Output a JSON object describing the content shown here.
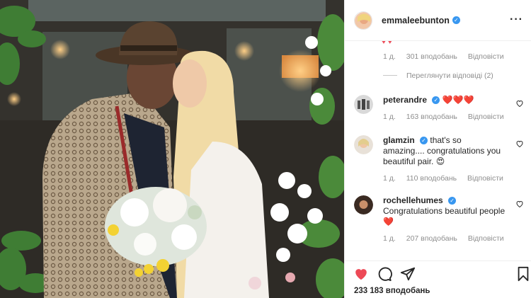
{
  "post": {
    "username": "emmaleebunton",
    "likes_label": "233 183 вподобань"
  },
  "top_meta": {
    "hearts": "♥ ♥",
    "time": "1 д.",
    "likes": "301 вподобань",
    "reply": "Відповісти",
    "view_replies": "Переглянути відповіді (2)"
  },
  "comments": [
    {
      "username": "peterandre",
      "text": "",
      "emoji": "❤️❤️❤️",
      "time": "1 д.",
      "likes": "163 вподобань",
      "reply": "Відповісти"
    },
    {
      "username": "glamzin",
      "text": "that's so amazing.... congratulations you beautiful pair.",
      "emoji": "😍",
      "time": "1 д.",
      "likes": "110 вподобань",
      "reply": "Відповісти"
    },
    {
      "username": "rochellehumes",
      "text": "Congratulations beautiful people",
      "emoji": "❤️",
      "time": "1 д.",
      "likes": "207 вподобань",
      "reply": "Відповісти"
    }
  ],
  "icons": {
    "like": "heart-icon",
    "comment": "comment-icon",
    "share": "share-icon",
    "save": "bookmark-icon",
    "more": "more-options-icon"
  },
  "colors": {
    "liked_red": "#ed4956",
    "verified_blue": "#3897f0",
    "muted_text": "#8e8e8e"
  }
}
